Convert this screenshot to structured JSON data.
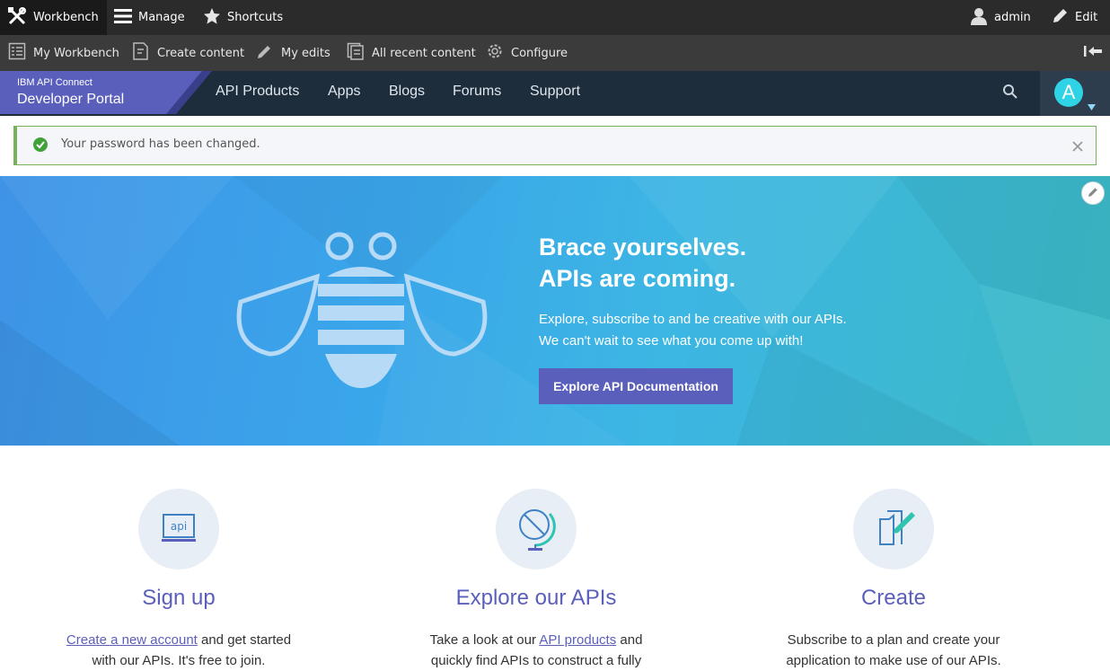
{
  "admin_toolbar": {
    "workbench_label": "Workbench",
    "manage_label": "Manage",
    "shortcuts_label": "Shortcuts",
    "user_label": "admin",
    "edit_label": "Edit"
  },
  "workbench_tray": {
    "items": [
      {
        "label": "My Workbench",
        "icon": "checklist-icon"
      },
      {
        "label": "Create content",
        "icon": "document-add-icon"
      },
      {
        "label": "My edits",
        "icon": "pencil-icon"
      },
      {
        "label": "All recent content",
        "icon": "documents-icon"
      },
      {
        "label": "Configure",
        "icon": "gear-icon"
      }
    ]
  },
  "site_nav": {
    "brand_small": "IBM API Connect",
    "brand_large": "Developer Portal",
    "links": [
      "API Products",
      "Apps",
      "Blogs",
      "Forums",
      "Support"
    ],
    "avatar_letter": "A"
  },
  "status_message": {
    "text": "Your password has been changed.",
    "type": "success"
  },
  "hero": {
    "title_line1": "Brace yourselves.",
    "title_line2": "APIs are coming.",
    "text_line1": "Explore, subscribe to and be creative with our APIs.",
    "text_line2": "We can't wait to see what you come up with!",
    "button_label": "Explore API Documentation"
  },
  "features": [
    {
      "title": "Sign up",
      "icon": "api-laptop-icon",
      "link_text": "Create a new account",
      "text_line1_after": " and get started",
      "text_line2": "with our APIs. It's free to join."
    },
    {
      "title": "Explore our APIs",
      "icon": "globe-icon",
      "text_line1_before": "Take a look at our ",
      "link_text": "API products",
      "text_line1_after": " and",
      "text_line2": "quickly find APIs to construct a fully"
    },
    {
      "title": "Create",
      "icon": "create-document-icon",
      "text_line1": "Subscribe to a plan and create your",
      "text_line2": "application to make use of our APIs."
    }
  ],
  "colors": {
    "accent": "#5a5fbc",
    "nav_bg": "#1e2d3b",
    "success": "#77b259",
    "avatar": "#2fd3e6"
  }
}
